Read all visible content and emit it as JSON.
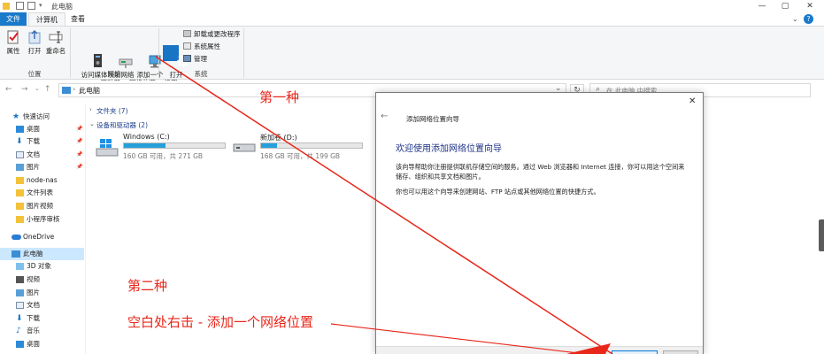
{
  "window": {
    "title": "此电脑",
    "help_glyph": "?",
    "controls": [
      "—",
      "▢",
      "✕"
    ]
  },
  "ribbon": {
    "tabs": [
      "文件",
      "计算机",
      "查看"
    ],
    "groups": {
      "location": {
        "label": "位置",
        "buttons": [
          "属性",
          "打开",
          "重命名"
        ]
      },
      "network": {
        "label": "网络",
        "buttons": [
          "访问媒体",
          "映射网络\n驱动器 ▾",
          "添加一个\n网络位置"
        ]
      },
      "system": {
        "label": "系统",
        "open_settings": "打开\n设置",
        "items": [
          "卸载或更改程序",
          "系统属性",
          "管理"
        ]
      }
    }
  },
  "address": {
    "path": "此电脑",
    "search_placeholder": "在 此电脑 中搜索",
    "back": "←",
    "forward": "→",
    "up": "↑",
    "dropdown": "⌄",
    "refresh": "↻"
  },
  "nav": {
    "quick_access": "快速访问",
    "quick_items": [
      "桌面",
      "下载",
      "文档",
      "图片",
      "node-nas",
      "文件列表",
      "图片视频",
      "小程序审核"
    ],
    "onedrive": "OneDrive",
    "this_pc": "此电脑",
    "pc_items": [
      "3D 对象",
      "视频",
      "图片",
      "文档",
      "下载",
      "音乐",
      "桌面"
    ]
  },
  "content": {
    "folders_header": "文件夹 (7)",
    "drives_header": "设备和驱动器 (2)",
    "drives": [
      {
        "name": "Windows (C:)",
        "free": "160 GB 可用，共 271 GB",
        "used_fraction": 0.41
      },
      {
        "name": "新加卷 (D:)",
        "free": "168 GB 可用，共 199 GB",
        "used_fraction": 0.16
      }
    ]
  },
  "dialog": {
    "title": "添加网络位置向导",
    "heading": "欢迎使用添加网络位置向导",
    "paragraph1": "该向导帮助你注册提供联机存储空间的服务。通过 Web 浏览器和 Internet 连接，你可以用这个空间来储存、组织和共享文档和图片。",
    "paragraph2": "你也可以用这个向导来创建网站、FTP 站点或其他网络位置的快捷方式。",
    "back_glyph": "←",
    "close_glyph": "✕"
  },
  "annotations": {
    "first": "第一种",
    "second": "第二种",
    "second_detail": "空白处右击 - 添加一个网络位置"
  },
  "colors": {
    "accent": "#1979ca",
    "drive_bar": "#26a0da",
    "annotation": "#e8261a",
    "dialog_heading": "#1e3287"
  }
}
